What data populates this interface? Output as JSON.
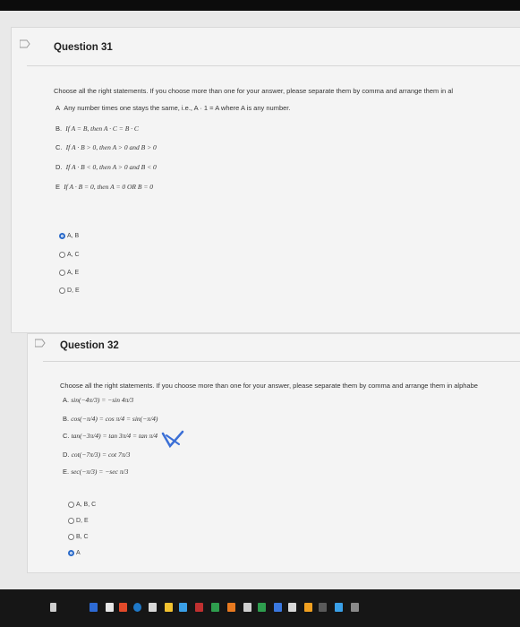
{
  "q31": {
    "title": "Question 31",
    "prompt": "Choose all the right statements. If you choose more than one for your answer, please separate them by comma and arrange them in al",
    "options": [
      {
        "letter": "A",
        "text": "Any number times one stays the same, i.e., A · 1 = A where A is any number."
      },
      {
        "letter": "B.",
        "text": "If A = B, then A · C = B · C"
      },
      {
        "letter": "C.",
        "text": "If A · B > 0, then A > 0 and B > 0"
      },
      {
        "letter": "D.",
        "text": "If A · B < 0, then A > 0 and B < 0"
      },
      {
        "letter": "E",
        "text": "If A · B = 0, then A = 0 OR B = 0"
      }
    ],
    "choices": [
      "A, B",
      "A, C",
      "A, E",
      "D, E"
    ],
    "selected_index": 0
  },
  "q32": {
    "title": "Question 32",
    "prompt": "Choose all the right statements. If you choose more than one for your answer, please separate them by comma and arrange them in alphabe",
    "options": [
      {
        "letter": "A.",
        "text": "sin(−4π/3) = −sin 4π/3"
      },
      {
        "letter": "B.",
        "text": "cos(−π/4) = cos π/4 = sin(−π/4)"
      },
      {
        "letter": "C.",
        "text": "tan(−3π/4) = tan 3π/4 = tan π/4"
      },
      {
        "letter": "D.",
        "text": "cot(−7π/3) = cot 7π/3"
      },
      {
        "letter": "E.",
        "text": "sec(−π/3) = −sec π/3"
      }
    ],
    "choices": [
      "A, B, C",
      "D, E",
      "B, C",
      "A"
    ],
    "selected_index": 3
  },
  "colors": {
    "accent": "#2a6ac9",
    "pen_mark": "#3b6fd6"
  }
}
